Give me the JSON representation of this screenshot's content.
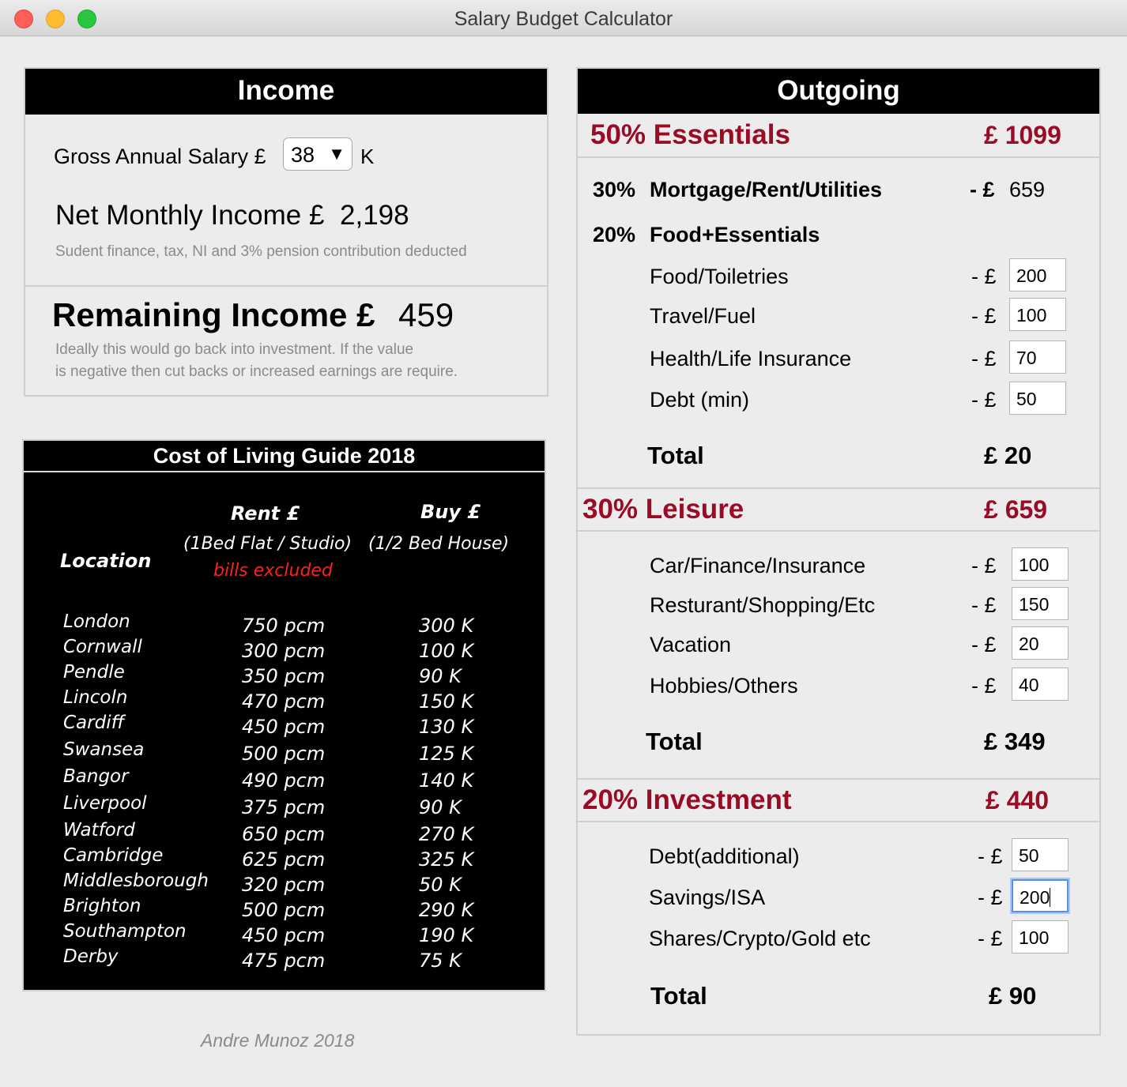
{
  "window": {
    "title": "Salary Budget Calculator"
  },
  "income": {
    "header": "Income",
    "salary_label": "Gross Annual Salary £",
    "salary_value": "38",
    "salary_arrow": "▼",
    "salary_unit": "K",
    "net_label": "Net Monthly Income £",
    "net_value": "2,198",
    "net_note": "Sudent finance, tax, NI and 3% pension contribution deducted",
    "remaining_label": "Remaining Income £",
    "remaining_value": "459",
    "remaining_note_1": "Ideally this would go back into investment. If the value",
    "remaining_note_2": "is negative then cut backs or increased earnings are require."
  },
  "guide": {
    "title": "Cost of Living Guide 2018",
    "col_location": "Location",
    "col_rent": "Rent £",
    "col_rent_sub": "(1Bed Flat / Studio)",
    "col_rent_note": "bills excluded",
    "col_buy": "Buy £",
    "col_buy_sub": "(1/2 Bed House)",
    "rows": [
      {
        "city": "London",
        "rent": "750 pcm",
        "buy": "300 K"
      },
      {
        "city": "Cornwall",
        "rent": "300 pcm",
        "buy": "100 K"
      },
      {
        "city": "Pendle",
        "rent": "350 pcm",
        "buy": "90 K"
      },
      {
        "city": "Lincoln",
        "rent": "470 pcm",
        "buy": "150 K"
      },
      {
        "city": "Cardiff",
        "rent": "450 pcm",
        "buy": "130 K"
      },
      {
        "city": "Swansea",
        "rent": "500 pcm",
        "buy": "125 K"
      },
      {
        "city": "Bangor",
        "rent": "490 pcm",
        "buy": "140 K"
      },
      {
        "city": "Liverpool",
        "rent": "375 pcm",
        "buy": "90 K"
      },
      {
        "city": "Watford",
        "rent": "650 pcm",
        "buy": "270 K"
      },
      {
        "city": "Cambridge",
        "rent": "625 pcm",
        "buy": "325 K"
      },
      {
        "city": "Middlesborough",
        "rent": "320 pcm",
        "buy": "50 K"
      },
      {
        "city": "Brighton",
        "rent": "500 pcm",
        "buy": "290 K"
      },
      {
        "city": "Southampton",
        "rent": "450 pcm",
        "buy": "190 K"
      },
      {
        "city": "Derby",
        "rent": "475 pcm",
        "buy": "75 K"
      }
    ]
  },
  "footer": "Andre Munoz 2018",
  "outgoing": {
    "header": "Outgoing",
    "essentials": {
      "title": "50% Essentials",
      "amount": "£ 1099",
      "mortgage_pct": "30%",
      "mortgage_label": "Mortgage/Rent/Utilities",
      "mortgage_prefix": "- £",
      "mortgage_value": "659",
      "food_pct": "20%",
      "food_label": "Food+Essentials",
      "items": [
        {
          "label": "Food/Toiletries",
          "prefix": "- £",
          "value": "200"
        },
        {
          "label": "Travel/Fuel",
          "prefix": "- £",
          "value": "100"
        },
        {
          "label": "Health/Life Insurance",
          "prefix": "- £",
          "value": "70"
        },
        {
          "label": "Debt (min)",
          "prefix": "- £",
          "value": "50"
        }
      ],
      "total_label": "Total",
      "total_value": "£ 20"
    },
    "leisure": {
      "title": "30% Leisure",
      "amount": "£ 659",
      "items": [
        {
          "label": "Car/Finance/Insurance",
          "prefix": "- £",
          "value": "100"
        },
        {
          "label": "Resturant/Shopping/Etc",
          "prefix": "- £",
          "value": "150"
        },
        {
          "label": "Vacation",
          "prefix": "- £",
          "value": "20"
        },
        {
          "label": "Hobbies/Others",
          "prefix": "- £",
          "value": "40"
        }
      ],
      "total_label": "Total",
      "total_value": "£  349"
    },
    "investment": {
      "title": "20% Investment",
      "amount": "£ 440",
      "items": [
        {
          "label": "Debt(additional)",
          "prefix": "- £",
          "value": "50"
        },
        {
          "label": "Savings/ISA",
          "prefix": "- £",
          "value": "200"
        },
        {
          "label": "Shares/Crypto/Gold etc",
          "prefix": "- £",
          "value": "100"
        }
      ],
      "total_label": "Total",
      "total_value": "£  90"
    }
  }
}
